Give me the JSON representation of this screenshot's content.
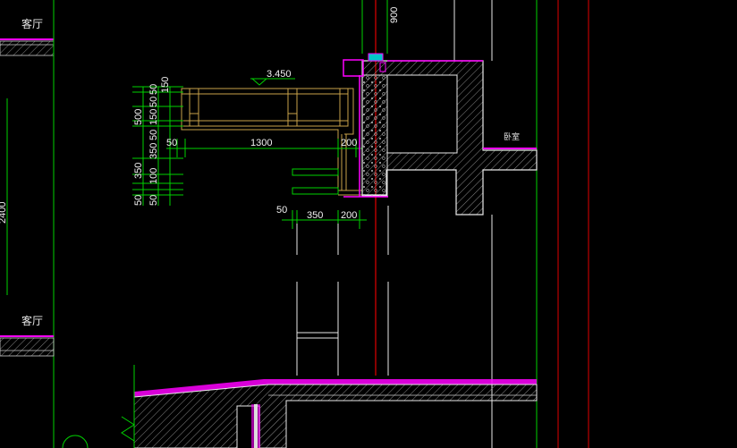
{
  "labels": {
    "room_top": "客厅",
    "room_bottom": "客厅",
    "room_right": "卧室",
    "level": "3.450",
    "top_dim": "900"
  },
  "dims": {
    "h_1300": "1300",
    "h_50_top": "50",
    "h_200_top": "200",
    "h_50_bot": "50",
    "h_350": "350",
    "h_200_bot": "200",
    "v_500": "500",
    "v_350": "350",
    "v_50a": "50",
    "v_50b": "50",
    "v_150a": "150",
    "v_50c": "50",
    "v_150b": "150",
    "v_350b": "350",
    "v_100": "100",
    "v_50d": "50",
    "v_50e": "50",
    "v_2400": "2400"
  },
  "colors": {
    "green": "#00d200",
    "magenta": "#ff00ff",
    "red": "#e00000",
    "gold": "#c9a24a",
    "white": "#e8e8e8",
    "hatch": "#9a9a9a"
  }
}
